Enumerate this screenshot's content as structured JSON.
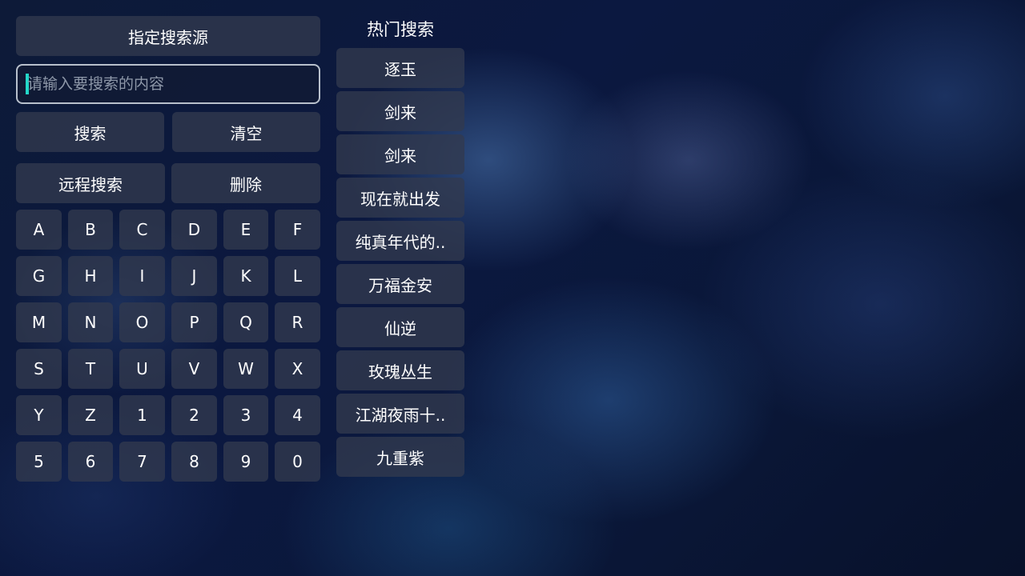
{
  "source_button": "指定搜索源",
  "search": {
    "placeholder": "请输入要搜索的内容",
    "value": ""
  },
  "actions": {
    "search": "搜索",
    "clear": "清空",
    "remote_search": "远程搜索",
    "delete": "删除"
  },
  "keyboard": {
    "rows": [
      [
        "A",
        "B",
        "C",
        "D",
        "E",
        "F"
      ],
      [
        "G",
        "H",
        "I",
        "J",
        "K",
        "L"
      ],
      [
        "M",
        "N",
        "O",
        "P",
        "Q",
        "R"
      ],
      [
        "S",
        "T",
        "U",
        "V",
        "W",
        "X"
      ],
      [
        "Y",
        "Z",
        "1",
        "2",
        "3",
        "4"
      ],
      [
        "5",
        "6",
        "7",
        "8",
        "9",
        "0"
      ]
    ]
  },
  "hot": {
    "title": "热门搜索",
    "items": [
      "逐玉",
      "剑来",
      "剑来",
      "现在就出发",
      "纯真年代的..",
      "万福金安",
      "仙逆",
      "玫瑰丛生",
      "江湖夜雨十..",
      "九重紫"
    ]
  }
}
